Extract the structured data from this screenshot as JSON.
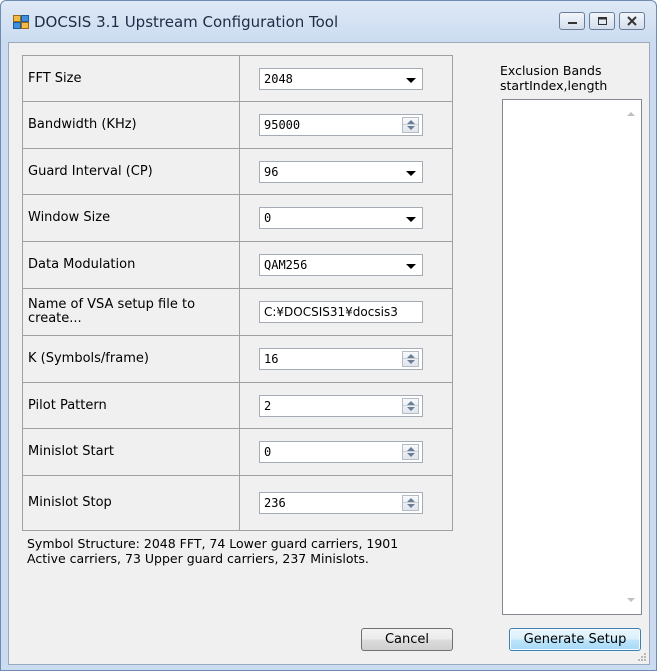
{
  "window": {
    "title": "DOCSIS 3.1 Upstream Configuration Tool",
    "icon": "app-window-icon",
    "controls": [
      "minimize-icon",
      "maximize-icon",
      "close-icon"
    ]
  },
  "form": {
    "rows": [
      {
        "label": "FFT Size",
        "value": "2048",
        "control": "dropdown"
      },
      {
        "label": "Bandwidth (KHz)",
        "value": "95000",
        "control": "spinner"
      },
      {
        "label": "Guard Interval (CP)",
        "value": "96",
        "control": "dropdown"
      },
      {
        "label": "Window Size",
        "value": "0",
        "control": "dropdown"
      },
      {
        "label": "Data Modulation",
        "value": "QAM256",
        "control": "dropdown"
      },
      {
        "label": "Name of VSA setup file to create...",
        "value": "C:¥DOCSIS31¥docsis3",
        "control": "text"
      },
      {
        "label": "K (Symbols/frame)",
        "value": "16",
        "control": "spinner"
      },
      {
        "label": "Pilot Pattern",
        "value": "2",
        "control": "spinner"
      },
      {
        "label": "Minislot Start",
        "value": "0",
        "control": "spinner"
      },
      {
        "label": "Minislot Stop",
        "value": "236",
        "control": "spinner"
      }
    ]
  },
  "summary": {
    "line1": "Symbol Structure: 2048 FFT, 74 Lower guard carriers, 1901",
    "line2": "Active carriers, 73 Upper guard carriers, 237 Minislots."
  },
  "exclusion": {
    "label_line1": "Exclusion Bands",
    "label_line2": "startIndex,length",
    "value": ""
  },
  "buttons": {
    "cancel": "Cancel",
    "generate": "Generate Setup"
  }
}
